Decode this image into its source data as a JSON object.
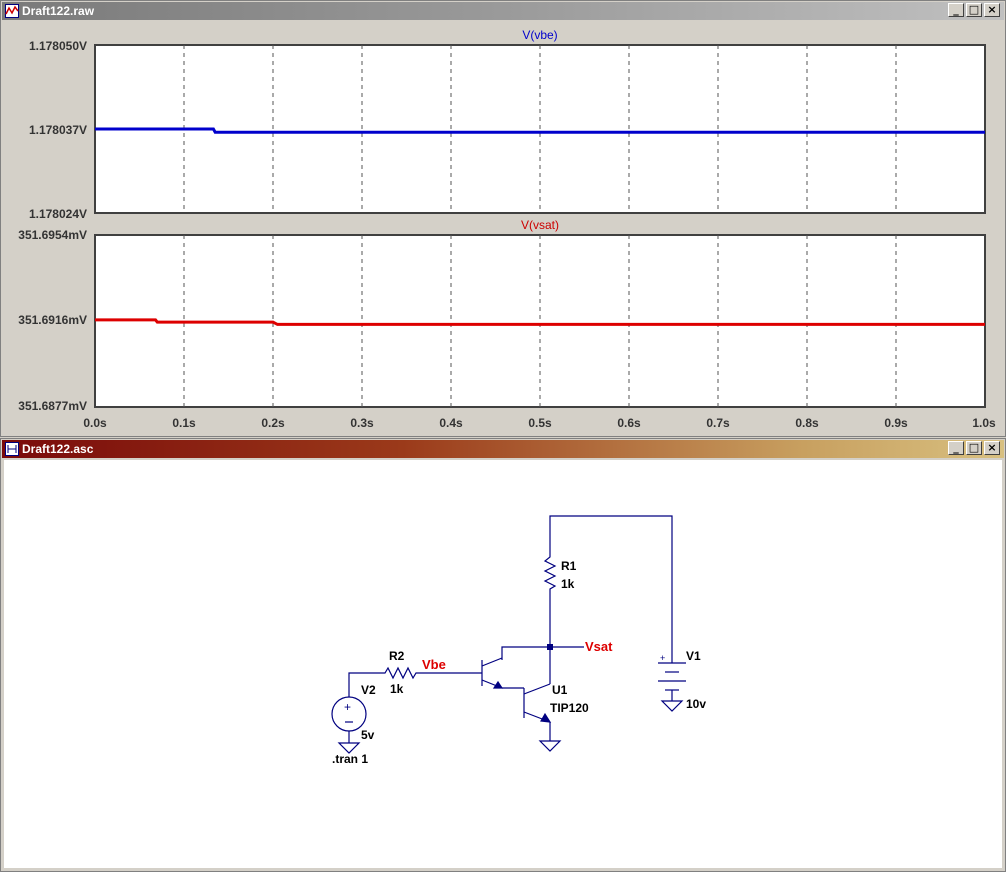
{
  "waveform_window": {
    "title": "Draft122.raw",
    "buttons": {
      "minimize": "_",
      "maximize": "□",
      "close": "×"
    }
  },
  "schematic_window": {
    "title": "Draft122.asc",
    "buttons": {
      "minimize": "_",
      "maximize": "□",
      "close": "×"
    }
  },
  "chart_data": [
    {
      "type": "line",
      "title": "V(vbe)",
      "title_color": "#0000cc",
      "series": [
        {
          "name": "V(vbe)",
          "color": "#0000cc",
          "x": [
            0.0,
            0.133,
            0.135,
            1.0
          ],
          "y": [
            1.178037,
            1.178037,
            1.1780365,
            1.1780365
          ]
        }
      ],
      "ylim": [
        1.178024,
        1.17805
      ],
      "yticks": [
        "1.178050V",
        "1.178037V",
        "1.178024V"
      ],
      "xlim": [
        0,
        1.0
      ],
      "grid": true
    },
    {
      "type": "line",
      "title": "V(vsat)",
      "title_color": "#cc0000",
      "series": [
        {
          "name": "V(vsat)",
          "color": "#dd0000",
          "x": [
            0.0,
            0.068,
            0.07,
            0.2,
            0.205,
            1.0
          ],
          "y": [
            351.6916,
            351.6916,
            351.6915,
            351.6915,
            351.6914,
            351.6914
          ]
        }
      ],
      "ylim": [
        351.6877,
        351.6954
      ],
      "yticks": [
        "351.6954mV",
        "351.6916mV",
        "351.6877mV"
      ],
      "xlim": [
        0,
        1.0
      ],
      "xticks": [
        "0.0s",
        "0.1s",
        "0.2s",
        "0.3s",
        "0.4s",
        "0.5s",
        "0.6s",
        "0.7s",
        "0.8s",
        "0.9s",
        "1.0s"
      ],
      "grid": true
    }
  ],
  "schematic": {
    "r1_name": "R1",
    "r1_value": "1k",
    "r2_name": "R2",
    "r2_value": "1k",
    "v1_name": "V1",
    "v1_value": "10v",
    "v2_name": "V2",
    "v2_value": "5v",
    "u1_name": "U1",
    "u1_value": "TIP120",
    "net_vbe": "Vbe",
    "net_vsat": "Vsat",
    "directive": ".tran 1",
    "wire_color": "#000080",
    "net_color": "#dd0000"
  }
}
